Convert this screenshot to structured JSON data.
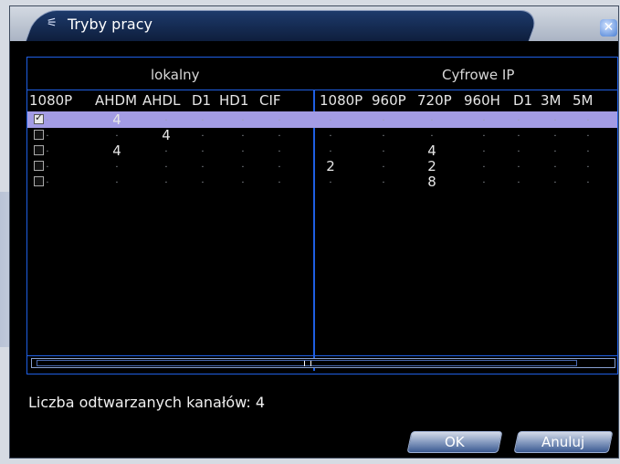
{
  "dialog": {
    "title": "Tryby pracy",
    "close_label": "✕"
  },
  "table": {
    "group_local": "lokalny",
    "group_ip": "Cyfrowe IP",
    "local_columns": [
      "1080P",
      "AHDM",
      "AHDL",
      "D1",
      "HD1",
      "CIF"
    ],
    "ip_columns": [
      "1080P",
      "960P",
      "720P",
      "960H",
      "D1",
      "3M",
      "5M"
    ],
    "rows": [
      {
        "checked": true,
        "local": [
          ".",
          "4",
          ".",
          ".",
          ".",
          "."
        ],
        "ip": [
          ".",
          ".",
          ".",
          ".",
          ".",
          ".",
          "."
        ]
      },
      {
        "checked": false,
        "local": [
          ".",
          ".",
          "4",
          ".",
          ".",
          "."
        ],
        "ip": [
          ".",
          ".",
          ".",
          ".",
          ".",
          ".",
          "."
        ]
      },
      {
        "checked": false,
        "local": [
          ".",
          "4",
          ".",
          ".",
          ".",
          "."
        ],
        "ip": [
          ".",
          ".",
          "4",
          ".",
          ".",
          ".",
          "."
        ]
      },
      {
        "checked": false,
        "local": [
          ".",
          ".",
          ".",
          ".",
          ".",
          "."
        ],
        "ip": [
          "2",
          ".",
          "2",
          ".",
          ".",
          ".",
          "."
        ]
      },
      {
        "checked": false,
        "local": [
          ".",
          ".",
          ".",
          ".",
          ".",
          "."
        ],
        "ip": [
          ".",
          ".",
          "8",
          ".",
          ".",
          ".",
          "."
        ]
      }
    ]
  },
  "status": {
    "text": "Liczba odtwarzanych kanałów: 4"
  },
  "buttons": {
    "ok": "OK",
    "cancel": "Anuluj"
  },
  "colors": {
    "grid_blue": "#1f5fe3",
    "selection": "#a39ce4"
  }
}
